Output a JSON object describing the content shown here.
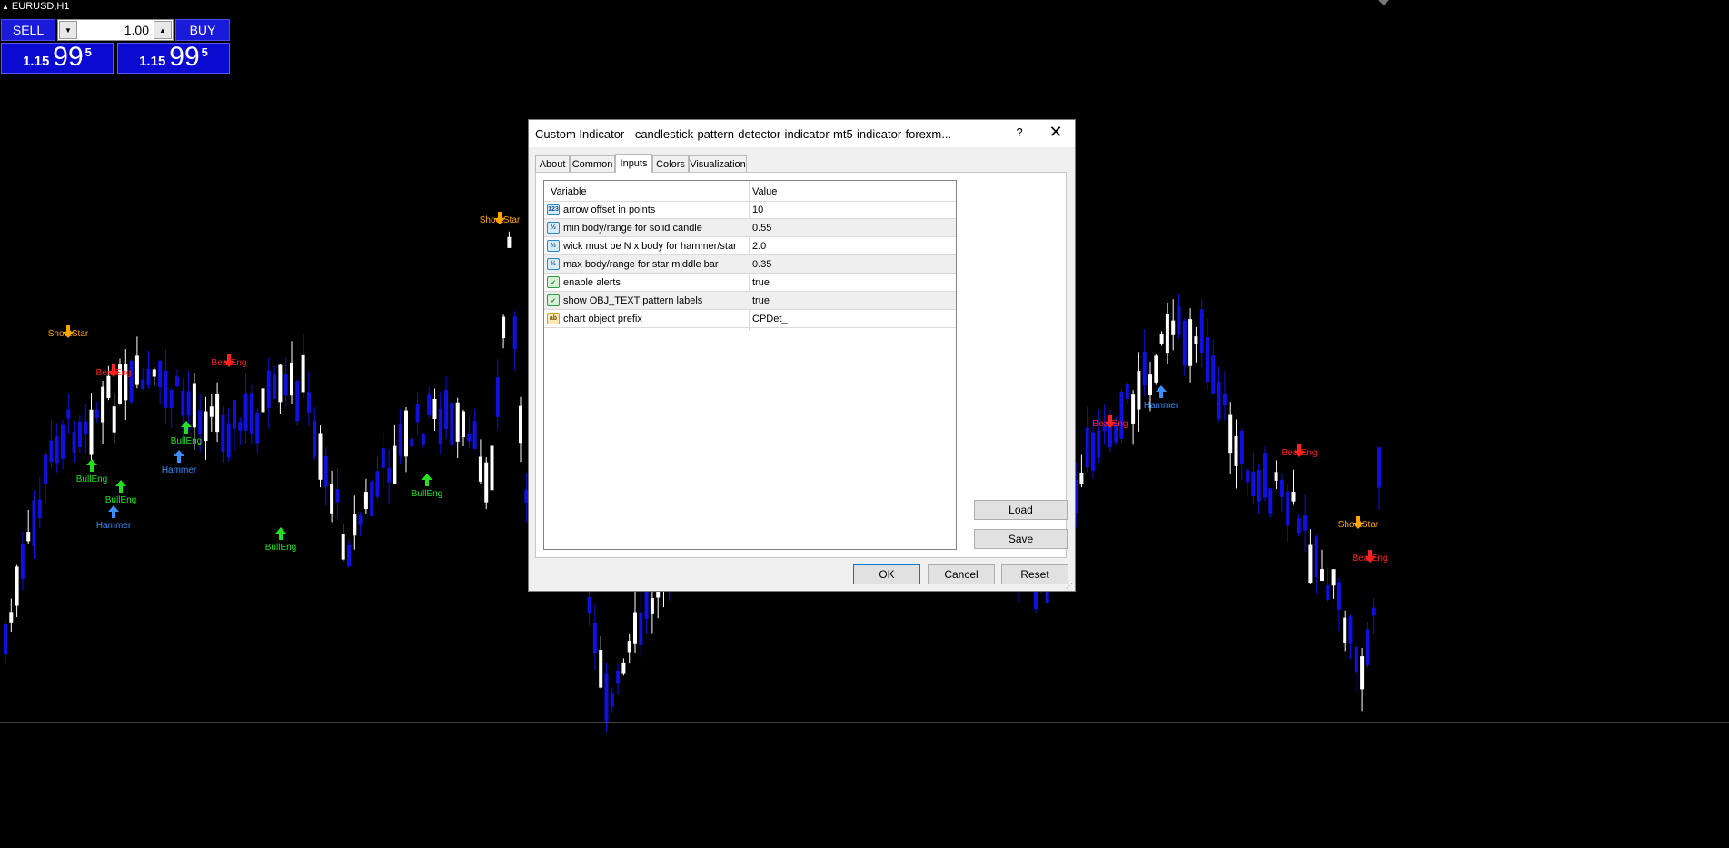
{
  "chart": {
    "symbol": "EURUSD,H1",
    "horizontal_line_color": "#808080",
    "pattern_labels": [
      {
        "text": "ShootStar",
        "color": "#ffa500",
        "dir": "down"
      },
      {
        "text": "BearEng",
        "color": "#ff2020",
        "dir": "down"
      },
      {
        "text": "BearEng",
        "color": "#ff2020",
        "dir": "down"
      },
      {
        "text": "BullEng",
        "color": "#20e020",
        "dir": "up"
      },
      {
        "text": "BullEng",
        "color": "#20e020",
        "dir": "up"
      },
      {
        "text": "Hammer",
        "color": "#3a90ff",
        "dir": "up"
      },
      {
        "text": "BullEng",
        "color": "#20e020",
        "dir": "up"
      },
      {
        "text": "Hammer",
        "color": "#3a90ff",
        "dir": "up"
      },
      {
        "text": "BullEng",
        "color": "#20e020",
        "dir": "up"
      },
      {
        "text": "BullEng",
        "color": "#20e020",
        "dir": "up"
      },
      {
        "text": "ShootStar",
        "color": "#ffa500",
        "dir": "down"
      },
      {
        "text": "Hammer",
        "color": "#3a90ff",
        "dir": "up"
      },
      {
        "text": "BearEng",
        "color": "#ff2020",
        "dir": "down"
      },
      {
        "text": "BearEng",
        "color": "#ff2020",
        "dir": "down"
      },
      {
        "text": "ShootStar",
        "color": "#ffa500",
        "dir": "down"
      },
      {
        "text": "BearEng",
        "color": "#ff2020",
        "dir": "down"
      }
    ]
  },
  "trade_panel": {
    "sell_label": "SELL",
    "buy_label": "BUY",
    "lot_value": "1.00",
    "sell_price": {
      "small": "1.15",
      "big": "99",
      "sup": "5"
    },
    "buy_price": {
      "small": "1.15",
      "big": "99",
      "sup": "5"
    }
  },
  "dialog": {
    "title": "Custom Indicator - candlestick-pattern-detector-indicator-mt5-indicator-forexm...",
    "help": "?",
    "close": "✕",
    "tabs": [
      "About",
      "Common",
      "Inputs",
      "Colors",
      "Visualization"
    ],
    "active_tab": "Inputs",
    "grid": {
      "col_variable": "Variable",
      "col_value": "Value",
      "rows": [
        {
          "icon": "123",
          "type": "num",
          "variable": "arrow offset in points",
          "value": "10"
        },
        {
          "icon": "½",
          "type": "num",
          "variable": "min body/range for solid candle",
          "value": "0.55"
        },
        {
          "icon": "½",
          "type": "num",
          "variable": "wick must be N x body for hammer/star",
          "value": "2.0"
        },
        {
          "icon": "½",
          "type": "num",
          "variable": "max body/range for star middle bar",
          "value": "0.35"
        },
        {
          "icon": "✓",
          "type": "bool",
          "variable": "enable alerts",
          "value": "true"
        },
        {
          "icon": "✓",
          "type": "bool",
          "variable": "show OBJ_TEXT pattern labels",
          "value": "true"
        },
        {
          "icon": "ab",
          "type": "str",
          "variable": "chart object prefix",
          "value": "CPDet_"
        }
      ]
    },
    "load": "Load",
    "save": "Save",
    "ok": "OK",
    "cancel": "Cancel",
    "reset": "Reset"
  }
}
